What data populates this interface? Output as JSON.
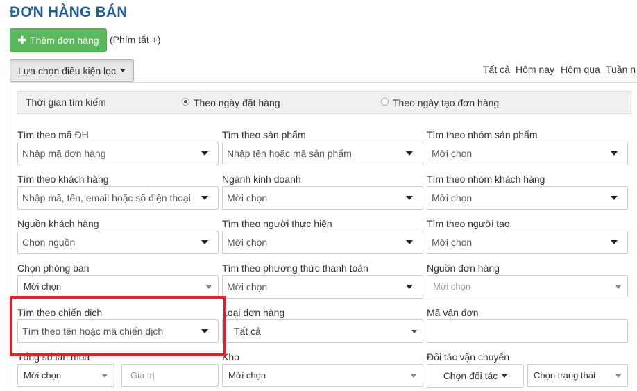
{
  "page": {
    "title": "ĐƠN HÀNG BÁN"
  },
  "toolbar": {
    "add_label": "Thêm đơn hàng",
    "add_icon": "plus-icon",
    "shortcut_hint": "(Phím tắt +)",
    "filter_label": "Lựa chọn điều kiện lọc"
  },
  "quick_filters": [
    "Tất cả",
    "Hôm nay",
    "Hôm qua",
    "Tuần n"
  ],
  "time_search": {
    "label": "Thời gian tìm kiếm",
    "options": [
      {
        "label": "Theo ngày đặt hàng",
        "selected": true
      },
      {
        "label": "Theo ngày tạo đơn hàng",
        "selected": false
      }
    ]
  },
  "filters": {
    "order_code": {
      "label": "Tìm theo mã ĐH",
      "placeholder": "Nhập mã đơn hàng"
    },
    "product": {
      "label": "Tìm theo sản phẩm",
      "placeholder": "Nhập tên hoặc mã sản phẩm"
    },
    "product_group": {
      "label": "Tìm theo nhóm sản phẩm",
      "placeholder": "Mời chọn"
    },
    "customer": {
      "label": "Tìm theo khách hàng",
      "placeholder": "Nhập mã, tên, email hoặc số điện thoại"
    },
    "industry": {
      "label": "Ngành kinh doanh",
      "placeholder": "Mời chọn"
    },
    "customer_group": {
      "label": "Tìm theo nhóm khách hàng",
      "placeholder": "Mời chọn"
    },
    "customer_source": {
      "label": "Nguồn khách hàng",
      "placeholder": "Chọn nguồn"
    },
    "performer": {
      "label": "Tìm theo người thực hiện",
      "placeholder": "Mời chọn"
    },
    "creator": {
      "label": "Tìm theo người tạo",
      "placeholder": "Mời chọn"
    },
    "department": {
      "label": "Chọn phòng ban",
      "placeholder": "Mời chọn"
    },
    "payment_method": {
      "label": "Tìm theo phương thức thanh toán",
      "placeholder": "Mời chọn"
    },
    "order_source": {
      "label": "Nguồn đơn hàng",
      "placeholder": "Mời chọn"
    },
    "campaign": {
      "label": "Tìm theo chiến dịch",
      "placeholder": "Tìm theo tên hoặc mã chiến dịch"
    },
    "order_type": {
      "label": "Loại đơn hàng",
      "value": "Tất cả"
    },
    "tracking_code": {
      "label": "Mã vận đơn",
      "value": ""
    },
    "total_purchases": {
      "label": "Tổng số lần mua",
      "select": "Mời chọn",
      "value_placeholder": "Giá trị"
    },
    "warehouse": {
      "label": "Kho",
      "placeholder": "Mời chọn"
    },
    "shipping_partner": {
      "label": "Đối tác vận chuyển",
      "button": "Chọn đối tác",
      "status": "Chọn trạng thái"
    }
  },
  "colors": {
    "title": "#1f5f9a",
    "add_button": "#5cb85c",
    "highlight": "#e2202a"
  }
}
